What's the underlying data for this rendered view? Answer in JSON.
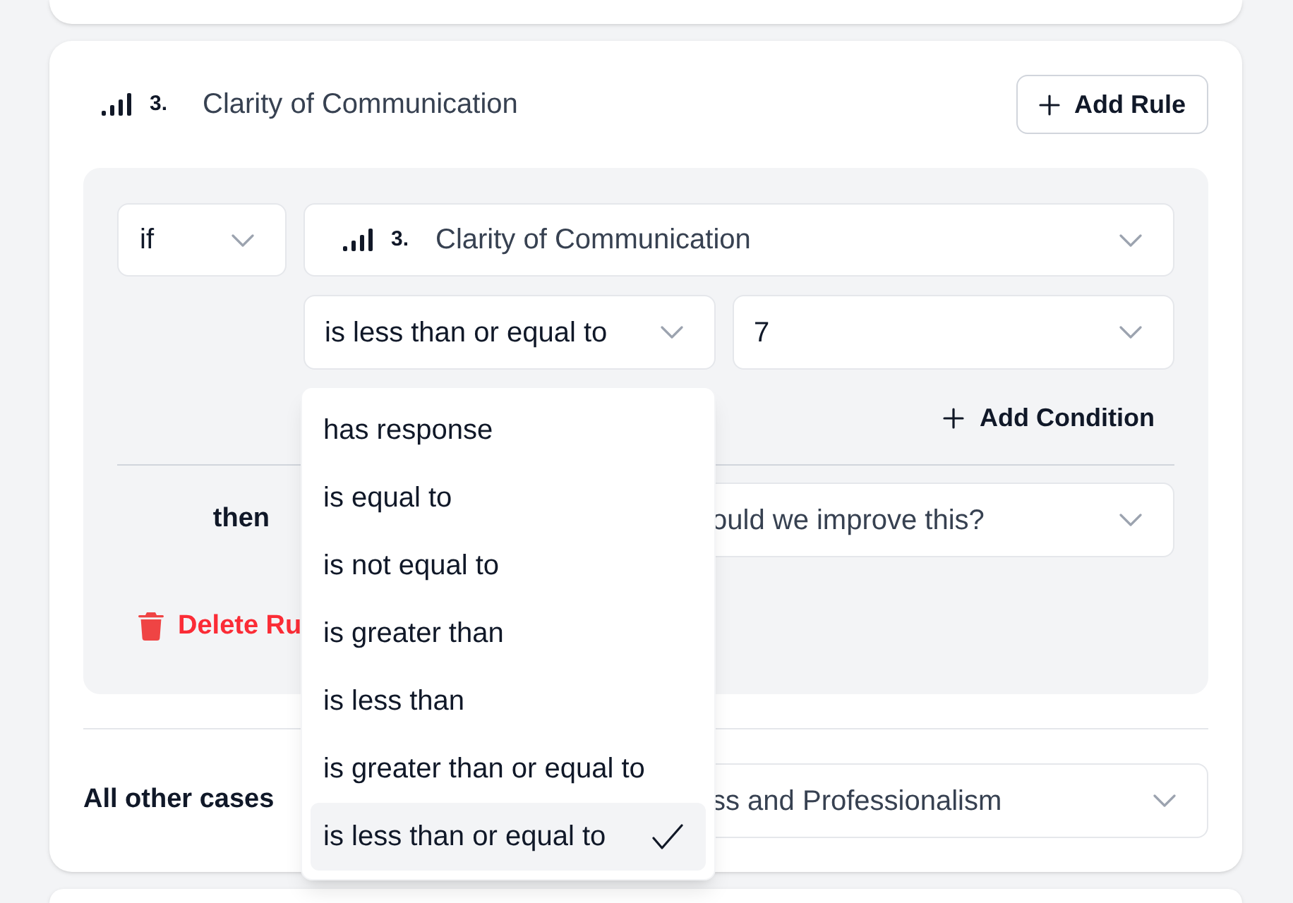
{
  "question": {
    "number": "3.",
    "title": "Clarity of Communication"
  },
  "add_rule_button": {
    "label": "Add Rule"
  },
  "rule": {
    "joiner_select": {
      "value": "if"
    },
    "question_select": {
      "number": "3.",
      "value": "Clarity of Communication"
    },
    "operator_select": {
      "value": "is less than or equal to",
      "expanded": true,
      "options": [
        {
          "label": "has response",
          "selected": false
        },
        {
          "label": "is equal to",
          "selected": false
        },
        {
          "label": "is not equal to",
          "selected": false
        },
        {
          "label": "is greater than",
          "selected": false
        },
        {
          "label": "is less than",
          "selected": false
        },
        {
          "label": "is greater than or equal to",
          "selected": false
        },
        {
          "label": "is less than or equal to",
          "selected": true
        }
      ]
    },
    "value_select": {
      "value": "7"
    },
    "add_condition_button": {
      "label": "Add Condition"
    },
    "then_label": "then",
    "then_select": {
      "value": "ould we improve this?"
    },
    "delete_button": {
      "label": "Delete Ru"
    }
  },
  "fallback": {
    "label": "All other cases",
    "select": {
      "value": "ss and Professionalism"
    }
  }
}
